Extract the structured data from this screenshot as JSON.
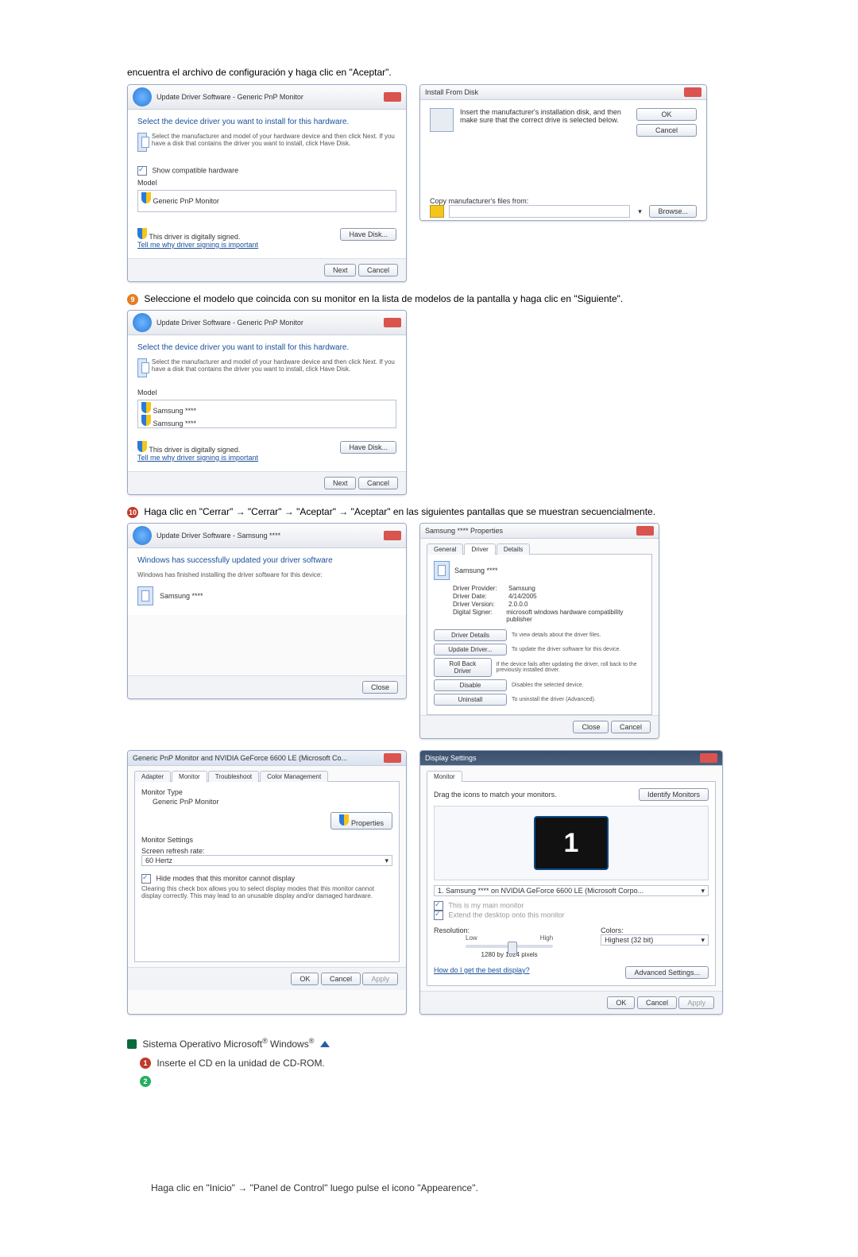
{
  "intro_text": "encuentra el archivo de configuración y haga clic en \"Aceptar\".",
  "step9": {
    "num": "9",
    "text": "Seleccione el modelo que coincida con su monitor en la lista de modelos de la pantalla y haga clic en \"Siguiente\"."
  },
  "step10": {
    "num": "10",
    "text": "Haga clic en \"Cerrar\" → \"Cerrar\" → \"Aceptar\" → \"Aceptar\" en las siguientes pantallas que se muestran secuencialmente."
  },
  "win_update1": {
    "breadcrumb": "Update Driver Software - Generic PnP Monitor",
    "heading": "Select the device driver you want to install for this hardware.",
    "sub": "Select the manufacturer and model of your hardware device and then click Next. If you have a disk that contains the driver you want to install, click Have Disk.",
    "show_compat": "Show compatible hardware",
    "model_label": "Model",
    "model_item": "Generic PnP Monitor",
    "signed": "This driver is digitally signed.",
    "tell_me": "Tell me why driver signing is important",
    "have_disk": "Have Disk...",
    "next": "Next",
    "cancel": "Cancel"
  },
  "win_install_disk": {
    "title": "Install From Disk",
    "msg": "Insert the manufacturer's installation disk, and then make sure that the correct drive is selected below.",
    "ok": "OK",
    "cancel": "Cancel",
    "copy_from": "Copy manufacturer's files from:",
    "browse": "Browse..."
  },
  "win_update2": {
    "breadcrumb": "Update Driver Software - Generic PnP Monitor",
    "heading": "Select the device driver you want to install for this hardware.",
    "sub": "Select the manufacturer and model of your hardware device and then click Next. If you have a disk that contains the driver you want to install, click Have Disk.",
    "model_label": "Model",
    "model_item1": "Samsung ****",
    "model_item2": "Samsung ****",
    "signed": "This driver is digitally signed.",
    "tell_me": "Tell me why driver signing is important",
    "have_disk": "Have Disk...",
    "next": "Next",
    "cancel": "Cancel"
  },
  "win_finished": {
    "breadcrumb": "Update Driver Software - Samsung ****",
    "heading": "Windows has successfully updated your driver software",
    "sub": "Windows has finished installing the driver software for this device:",
    "device": "Samsung ****",
    "close": "Close"
  },
  "win_props": {
    "title": "Samsung **** Properties",
    "tabs": {
      "general": "General",
      "driver": "Driver",
      "details": "Details"
    },
    "device": "Samsung ****",
    "provider_k": "Driver Provider:",
    "provider_v": "Samsung",
    "date_k": "Driver Date:",
    "date_v": "4/14/2005",
    "version_k": "Driver Version:",
    "version_v": "2.0.0.0",
    "signer_k": "Digital Signer:",
    "signer_v": "microsoft windows hardware compatibility publisher",
    "btn_details": "Driver Details",
    "desc_details": "To view details about the driver files.",
    "btn_update": "Update Driver...",
    "desc_update": "To update the driver software for this device.",
    "btn_rollback": "Roll Back Driver",
    "desc_rollback": "If the device fails after updating the driver, roll back to the previously installed driver.",
    "btn_disable": "Disable",
    "desc_disable": "Disables the selected device.",
    "btn_uninstall": "Uninstall",
    "desc_uninstall": "To uninstall the driver (Advanced).",
    "close": "Close",
    "cancel": "Cancel"
  },
  "win_monitor_tab": {
    "title": "Generic PnP Monitor and NVIDIA GeForce 6600 LE (Microsoft Co...",
    "tabs": {
      "adapter": "Adapter",
      "monitor": "Monitor",
      "troubleshoot": "Troubleshoot",
      "color": "Color Management"
    },
    "type_label": "Monitor Type",
    "type_value": "Generic PnP Monitor",
    "properties": "Properties",
    "settings_label": "Monitor Settings",
    "refresh_label": "Screen refresh rate:",
    "refresh_value": "60 Hertz",
    "hide_modes": "Hide modes that this monitor cannot display",
    "hide_desc": "Clearing this check box allows you to select display modes that this monitor cannot display correctly. This may lead to an unusable display and/or damaged hardware.",
    "ok": "OK",
    "cancel": "Cancel",
    "apply": "Apply"
  },
  "win_display": {
    "title": "Display Settings",
    "tab": "Monitor",
    "drag": "Drag the icons to match your monitors.",
    "identify": "Identify Monitors",
    "mon_num": "1",
    "combo": "1. Samsung **** on NVIDIA GeForce 6600 LE (Microsoft Corpo...",
    "main_mon": "This is my main monitor",
    "extend": "Extend the desktop onto this monitor",
    "res_label": "Resolution:",
    "low": "Low",
    "high": "High",
    "res_value": "1280 by 1024 pixels",
    "colors_label": "Colors:",
    "colors_value": "Highest (32 bit)",
    "best_display": "How do I get the best display?",
    "adv": "Advanced Settings...",
    "ok": "OK",
    "cancel": "Cancel",
    "apply": "Apply"
  },
  "os_line": {
    "prefix": "Sistema Operativo Microsoft",
    "win": "Windows"
  },
  "sub1": {
    "num": "1",
    "text": "Inserte el CD en la unidad de CD-ROM."
  },
  "sub2": {
    "num": "2"
  },
  "bottom_note": "Haga clic en \"Inicio\" → \"Panel de Control\" luego pulse el icono \"Appearence\"."
}
